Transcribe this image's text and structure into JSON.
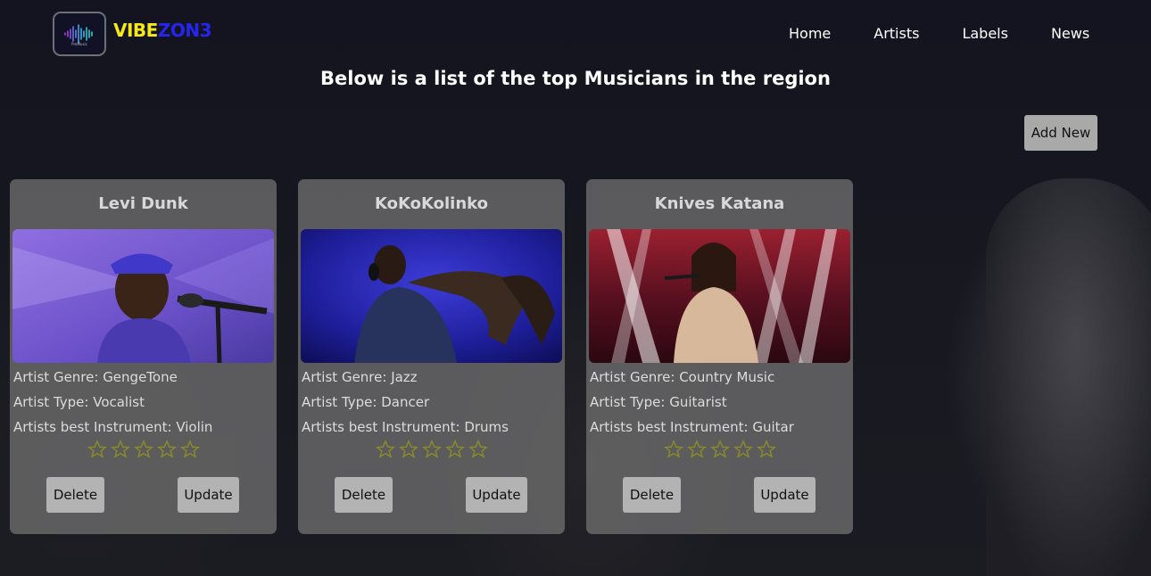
{
  "brand": {
    "part1": "VIBE",
    "part2": "ZON3",
    "logo_text": "ProMusic"
  },
  "nav": {
    "items": [
      "Home",
      "Artists",
      "Labels",
      "News"
    ]
  },
  "page": {
    "title": "Below is a list of the top Musicians in the region"
  },
  "add_new_label": "Add New",
  "cards": [
    {
      "name": "Levi Dunk",
      "genre": "Artist Genre: GengeTone",
      "type": "Artist Type: Vocalist",
      "instrument": "Artists best Instrument: Violin",
      "rating": 0,
      "delete_label": "Delete",
      "update_label": "Update"
    },
    {
      "name": "KoKoKolinko",
      "genre": "Artist Genre: Jazz",
      "type": "Artist Type: Dancer",
      "instrument": "Artists best Instrument: Drums",
      "rating": 0,
      "delete_label": "Delete",
      "update_label": "Update"
    },
    {
      "name": "Knives Katana",
      "genre": "Artist Genre: Country Music",
      "type": "Artist Type: Guitarist",
      "instrument": "Artists best Instrument: Guitar",
      "rating": 0,
      "delete_label": "Delete",
      "update_label": "Update"
    }
  ],
  "colors": {
    "brand_yellow": "#f5e91a",
    "brand_blue": "#2525ee",
    "star_outline": "#8a8a2a",
    "card_bg": "#6e6e6e",
    "button_bg": "#b3b3b3"
  },
  "icons": [
    "logo-icon",
    "star-icon"
  ]
}
